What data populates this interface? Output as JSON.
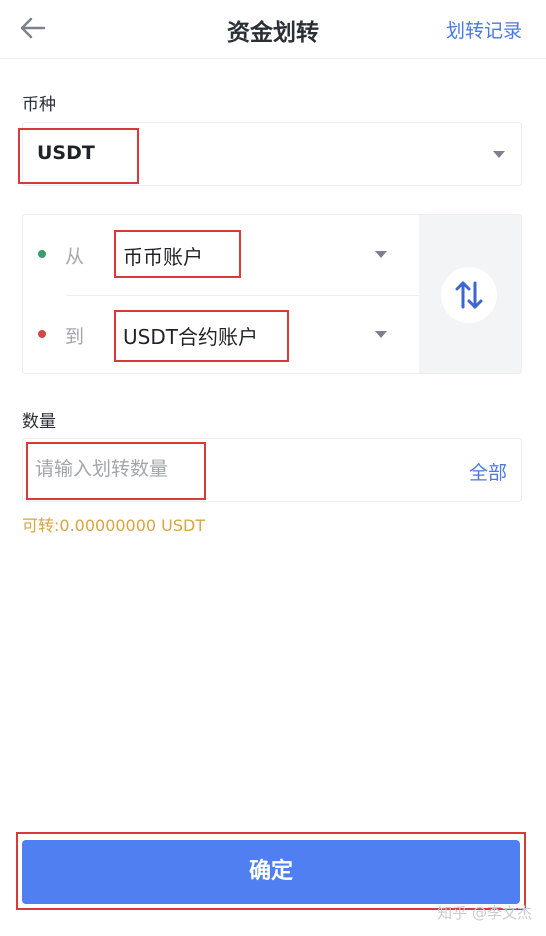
{
  "header": {
    "title": "资金划转",
    "history_link": "划转记录"
  },
  "currency": {
    "label": "币种",
    "selected": "USDT"
  },
  "transfer": {
    "from_label": "从",
    "from_account": "币币账户",
    "to_label": "到",
    "to_account": "USDT合约账户"
  },
  "amount": {
    "label": "数量",
    "placeholder": "请输入划转数量",
    "all_button": "全部",
    "available": "可转:0.00000000 USDT"
  },
  "confirm_button": "确定",
  "watermark": "知乎 @李文杰",
  "icons": {
    "back": "back-arrow-icon",
    "swap": "swap-vertical-icon",
    "caret": "caret-down-icon"
  },
  "colors": {
    "accent": "#4a78e4",
    "button": "#4f7ff0",
    "from_dot": "#3a9d6e",
    "to_dot": "#d04a4a",
    "available_text": "#d9a441",
    "highlight": "#d83a3a"
  }
}
